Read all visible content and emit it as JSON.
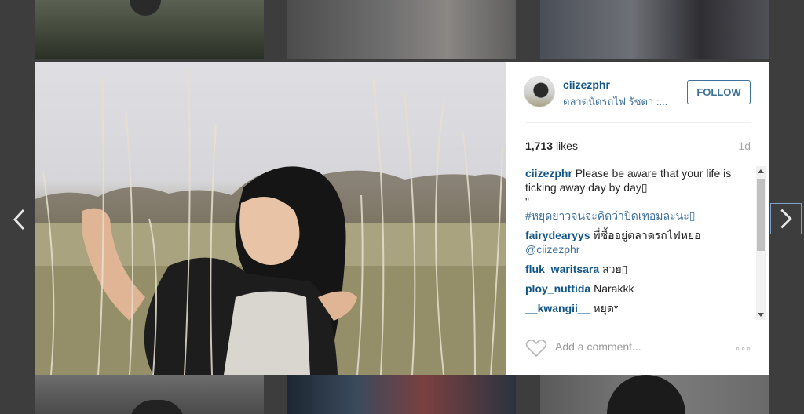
{
  "post": {
    "username": "ciizezphr",
    "location": "ตลาดนัดรถไฟ รัชดา :...",
    "follow_label": "FOLLOW",
    "likes_count": "1,713",
    "likes_label": "likes",
    "time_ago": "1d",
    "caption_text": "Please be aware that your life is ticking away day by day▯",
    "caption_quote": "\"",
    "caption_hashtag": "#หยุดยาวจนจะคิดว่าปิดเทอมละนะ▯",
    "add_comment_placeholder": "Add a comment...",
    "more_label": "◦◦◦"
  },
  "comments": [
    {
      "user": "fairydearyys",
      "text": "พี่ซื้ออยู่ตลาดรถไฟหยอ",
      "mention": "@ciizezphr"
    },
    {
      "user": "fluk_waritsara",
      "text": "สวย▯",
      "mention": ""
    },
    {
      "user": "ploy_nuttida",
      "text": "Narakkk",
      "mention": ""
    },
    {
      "user": "__kwangii__",
      "text": "หยุด*",
      "mention": ""
    }
  ],
  "icons": {
    "prev": "chevron-left-icon",
    "next": "chevron-right-icon",
    "heart": "heart-icon"
  },
  "colors": {
    "username": "#125688",
    "link": "#3f729b",
    "backdrop": "#3d3d3d"
  }
}
